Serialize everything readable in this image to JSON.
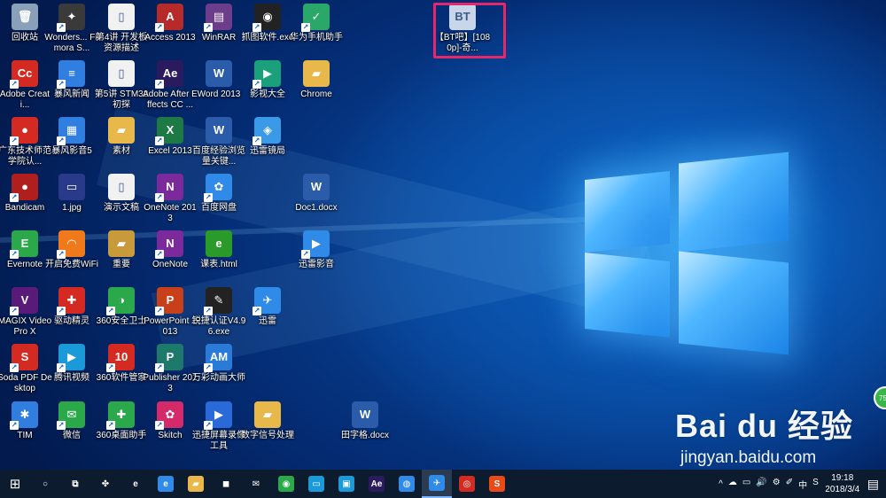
{
  "desktop_icons": [
    {
      "label": "回收站",
      "glyph": "🗑",
      "color": "#8aa0b8"
    },
    {
      "label": "Wonders... Filmora S...",
      "glyph": "✦",
      "color": "#3a3a3a"
    },
    {
      "label": "第4讲 开发板资源描述",
      "glyph": "▯",
      "color": "#f1f1f1"
    },
    {
      "label": "Access 2013",
      "glyph": "A",
      "color": "#b62a2a"
    },
    {
      "label": "WinRAR",
      "glyph": "▤",
      "color": "#6b3d8a"
    },
    {
      "label": "抓图软件.exe",
      "glyph": "◉",
      "color": "#222"
    },
    {
      "label": "华为手机助手",
      "glyph": "✓",
      "color": "#2aa86a"
    },
    {
      "label": "【BT吧】[1080p]-奇...",
      "glyph": "BT",
      "color": "#c9d6ea"
    },
    {
      "label": "Adobe Creati...",
      "glyph": "Cc",
      "color": "#d42a22"
    },
    {
      "label": "暴风新闻",
      "glyph": "≡",
      "color": "#2f7ee0"
    },
    {
      "label": "第5讲 STM32初探",
      "glyph": "▯",
      "color": "#f1f1f1"
    },
    {
      "label": "Adobe After Effects CC ...",
      "glyph": "Ae",
      "color": "#2a1a5e"
    },
    {
      "label": "Word 2013",
      "glyph": "W",
      "color": "#2a5caa"
    },
    {
      "label": "影视大全",
      "glyph": "▶",
      "color": "#1aa07a"
    },
    {
      "label": "Chrome",
      "glyph": "▰",
      "color": "#e8b84a"
    },
    {
      "label": "广东技术师范学院认...",
      "glyph": "●",
      "color": "#d42a22"
    },
    {
      "label": "暴风影音5",
      "glyph": "▦",
      "color": "#2f7ee0"
    },
    {
      "label": "素材",
      "glyph": "▰",
      "color": "#e8b84a"
    },
    {
      "label": "Excel 2013",
      "glyph": "X",
      "color": "#1d7a45"
    },
    {
      "label": "百度经验浏览量关键...",
      "glyph": "W",
      "color": "#2a5caa"
    },
    {
      "label": "迅雷镜局",
      "glyph": "◈",
      "color": "#3a9ae8"
    },
    {
      "label": "Bandicam",
      "glyph": "●",
      "color": "#b01e1e"
    },
    {
      "label": "1.jpg",
      "glyph": "▭",
      "color": "#2a3a8a"
    },
    {
      "label": "演示文稿",
      "glyph": "▯",
      "color": "#f1f1f1"
    },
    {
      "label": "OneNote 2013",
      "glyph": "N",
      "color": "#7a2a9a"
    },
    {
      "label": "百度网盘",
      "glyph": "✿",
      "color": "#2f8ae8"
    },
    {
      "label": "Doc1.docx",
      "glyph": "W",
      "color": "#2a5caa"
    },
    {
      "label": "Evernote",
      "glyph": "E",
      "color": "#2aa84a"
    },
    {
      "label": "开启免费WiFi",
      "glyph": "◠",
      "color": "#f07a1a"
    },
    {
      "label": "重要",
      "glyph": "▰",
      "color": "#c89a3a"
    },
    {
      "label": "OneNote",
      "glyph": "N",
      "color": "#7a2a9a"
    },
    {
      "label": "课表.html",
      "glyph": "e",
      "color": "#2a9a2a"
    },
    {
      "label": "迅雷影音",
      "glyph": "▶",
      "color": "#2f8ae8"
    },
    {
      "label": "MAGIX Video Pro X",
      "glyph": "V",
      "color": "#5a1a7a"
    },
    {
      "label": "驱动精灵",
      "glyph": "✚",
      "color": "#d42a22"
    },
    {
      "label": "360安全卫士",
      "glyph": "◑",
      "color": "#2aa84a"
    },
    {
      "label": "PowerPoint 2013",
      "glyph": "P",
      "color": "#c8401a"
    },
    {
      "label": "锐捷认证V4.96.exe",
      "glyph": "✎",
      "color": "#222"
    },
    {
      "label": "迅雷",
      "glyph": "✈",
      "color": "#2f8ae8"
    },
    {
      "label": "Soda PDF Desktop",
      "glyph": "S",
      "color": "#d42a22"
    },
    {
      "label": "腾讯视频",
      "glyph": "▶",
      "color": "#1a9ad8"
    },
    {
      "label": "360软件管家",
      "glyph": "10",
      "color": "#d42a22"
    },
    {
      "label": "Publisher 2013",
      "glyph": "P",
      "color": "#1d7a6a"
    },
    {
      "label": "万彩动画大师",
      "glyph": "AM",
      "color": "#2a7ad8"
    },
    {
      "label": "TIM",
      "glyph": "✱",
      "color": "#2f7ee0"
    },
    {
      "label": "微信",
      "glyph": "✉",
      "color": "#2aa84a"
    },
    {
      "label": "360桌面助手",
      "glyph": "✚",
      "color": "#2aa84a"
    },
    {
      "label": "Skitch",
      "glyph": "✿",
      "color": "#d42a6a"
    },
    {
      "label": "迅捷屏幕录像工具",
      "glyph": "▶",
      "color": "#2a6ad8"
    },
    {
      "label": "数字信号处理",
      "glyph": "▰",
      "color": "#e8b84a"
    },
    {
      "label": "田字格.docx",
      "glyph": "W",
      "color": "#2a5caa"
    }
  ],
  "taskbar": {
    "start": "⊞",
    "items": [
      {
        "glyph": "○",
        "name": "cortana-icon",
        "color": ""
      },
      {
        "glyph": "⧉",
        "name": "task-view-icon",
        "color": ""
      },
      {
        "glyph": "✤",
        "name": "fan-app-icon",
        "color": ""
      },
      {
        "glyph": "e",
        "name": "ie-icon",
        "color": ""
      },
      {
        "glyph": "e",
        "name": "edge-icon",
        "color": "#2f8ae8"
      },
      {
        "glyph": "▰",
        "name": "explorer-icon",
        "color": "#e8b84a"
      },
      {
        "glyph": "◼",
        "name": "store-icon",
        "color": ""
      },
      {
        "glyph": "✉",
        "name": "mail-icon",
        "color": ""
      },
      {
        "glyph": "◉",
        "name": "360-icon",
        "color": "#2aa84a"
      },
      {
        "glyph": "▭",
        "name": "laptop-app-icon",
        "color": "#1a9ad8"
      },
      {
        "glyph": "▣",
        "name": "media-app-icon",
        "color": "#1a9ad8"
      },
      {
        "glyph": "Ae",
        "name": "after-effects-icon",
        "color": "#2a1a5e"
      },
      {
        "glyph": "◍",
        "name": "browser-icon",
        "color": "#2f8ae8"
      },
      {
        "glyph": "✈",
        "name": "thunder-icon",
        "color": "#2f8ae8"
      },
      {
        "glyph": "◎",
        "name": "netease-music-icon",
        "color": "#d42a22"
      },
      {
        "glyph": "S",
        "name": "sogou-icon",
        "color": "#e84a1a"
      }
    ],
    "tray": {
      "chevron": "^",
      "icons": [
        "☁",
        "▭",
        "🔊",
        "⚙",
        "✐",
        "中",
        "S"
      ],
      "time": "19:18",
      "date": "2018/3/4",
      "notifications": "▤"
    }
  },
  "watermark": {
    "line1": "Bai du 经验",
    "line2": "jingyan.baidu.com"
  },
  "side_badge": "75"
}
